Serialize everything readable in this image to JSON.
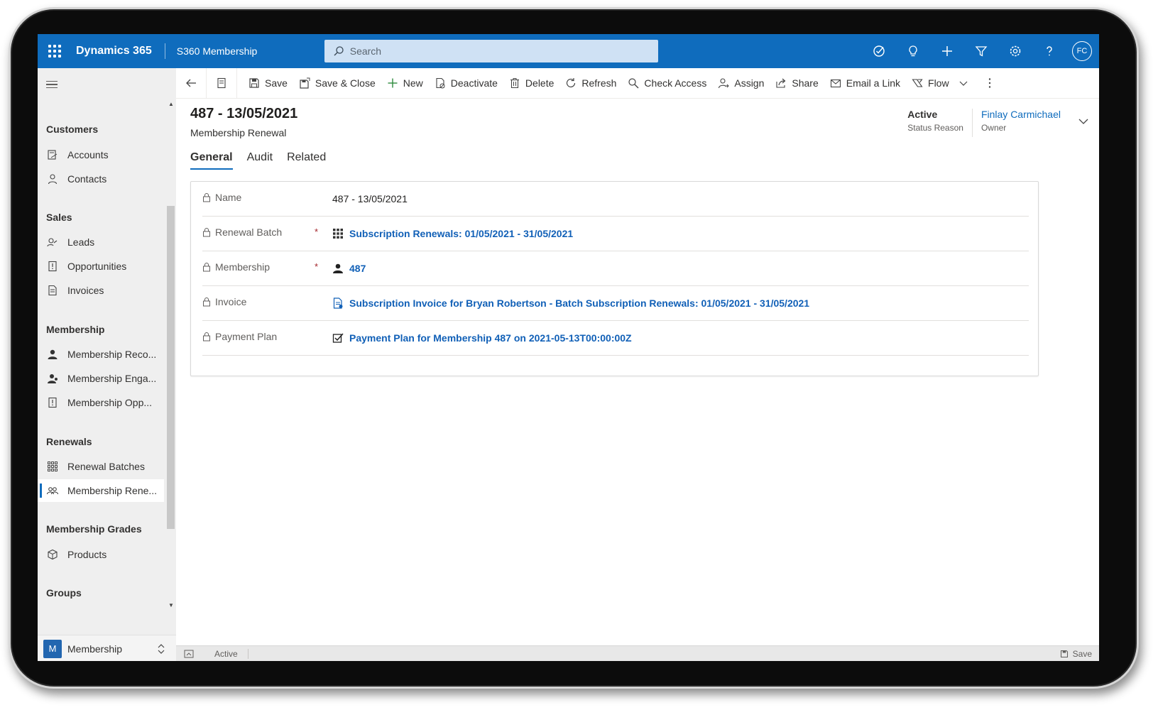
{
  "topbar": {
    "brand": "Dynamics 365",
    "app_name": "S360 Membership",
    "search_placeholder": "Search",
    "user_initials": "FC",
    "icons": [
      "task-icon",
      "lightbulb-icon",
      "plus-icon",
      "filter-icon",
      "settings-icon",
      "help-icon"
    ]
  },
  "sidebar": {
    "groups": [
      {
        "title": "Customers",
        "items": [
          {
            "label": "Accounts",
            "icon": "account-icon"
          },
          {
            "label": "Contacts",
            "icon": "contact-icon"
          }
        ]
      },
      {
        "title": "Sales",
        "items": [
          {
            "label": "Leads",
            "icon": "leads-icon"
          },
          {
            "label": "Opportunities",
            "icon": "opportunity-icon"
          },
          {
            "label": "Invoices",
            "icon": "invoice-icon"
          }
        ]
      },
      {
        "title": "Membership",
        "items": [
          {
            "label": "Membership Reco...",
            "icon": "person-icon"
          },
          {
            "label": "Membership Enga...",
            "icon": "person-engagement-icon"
          },
          {
            "label": "Membership Opp...",
            "icon": "opportunity-icon"
          }
        ]
      },
      {
        "title": "Renewals",
        "items": [
          {
            "label": "Renewal Batches",
            "icon": "grid-icon"
          },
          {
            "label": "Membership Rene...",
            "icon": "people-icon",
            "selected": true
          }
        ]
      },
      {
        "title": "Membership Grades",
        "items": [
          {
            "label": "Products",
            "icon": "cube-icon"
          }
        ]
      },
      {
        "title": "Groups",
        "items": []
      }
    ],
    "area": {
      "badge": "M",
      "label": "Membership"
    }
  },
  "commandbar": {
    "buttons": [
      {
        "label": "Save",
        "icon": "save-icon"
      },
      {
        "label": "Save & Close",
        "icon": "save-close-icon"
      },
      {
        "label": "New",
        "icon": "plus-icon"
      },
      {
        "label": "Deactivate",
        "icon": "deactivate-icon"
      },
      {
        "label": "Delete",
        "icon": "trash-icon"
      },
      {
        "label": "Refresh",
        "icon": "refresh-icon"
      },
      {
        "label": "Check Access",
        "icon": "check-access-icon"
      },
      {
        "label": "Assign",
        "icon": "assign-icon"
      },
      {
        "label": "Share",
        "icon": "share-icon"
      },
      {
        "label": "Email a Link",
        "icon": "email-icon"
      },
      {
        "label": "Flow",
        "icon": "flow-icon"
      }
    ]
  },
  "record": {
    "title": "487 -  13/05/2021",
    "entity": "Membership Renewal",
    "status_value": "Active",
    "status_label": "Status Reason",
    "owner_value": "Finlay Carmichael",
    "owner_label": "Owner"
  },
  "tabs": [
    "General",
    "Audit",
    "Related"
  ],
  "form": {
    "fields": [
      {
        "label": "Name",
        "value": "487 -  13/05/2021",
        "type": "text",
        "required": false
      },
      {
        "label": "Renewal Batch",
        "value": "Subscription Renewals: 01/05/2021 - 31/05/2021",
        "type": "lookup",
        "icon": "grid-icon",
        "required": true
      },
      {
        "label": "Membership",
        "value": "487",
        "type": "lookup",
        "icon": "person-icon",
        "required": true
      },
      {
        "label": "Invoice",
        "value": "Subscription Invoice for Bryan Robertson - Batch Subscription Renewals: 01/05/2021 - 31/05/2021",
        "type": "lookup",
        "icon": "invoice-icon",
        "required": false
      },
      {
        "label": "Payment Plan",
        "value": "Payment Plan for Membership 487 on 2021-05-13T00:00:00Z",
        "type": "lookup",
        "icon": "payment-plan-icon",
        "required": false
      }
    ],
    "required_marker": "*"
  },
  "statusbar": {
    "status": "Active",
    "save_label": "Save"
  }
}
